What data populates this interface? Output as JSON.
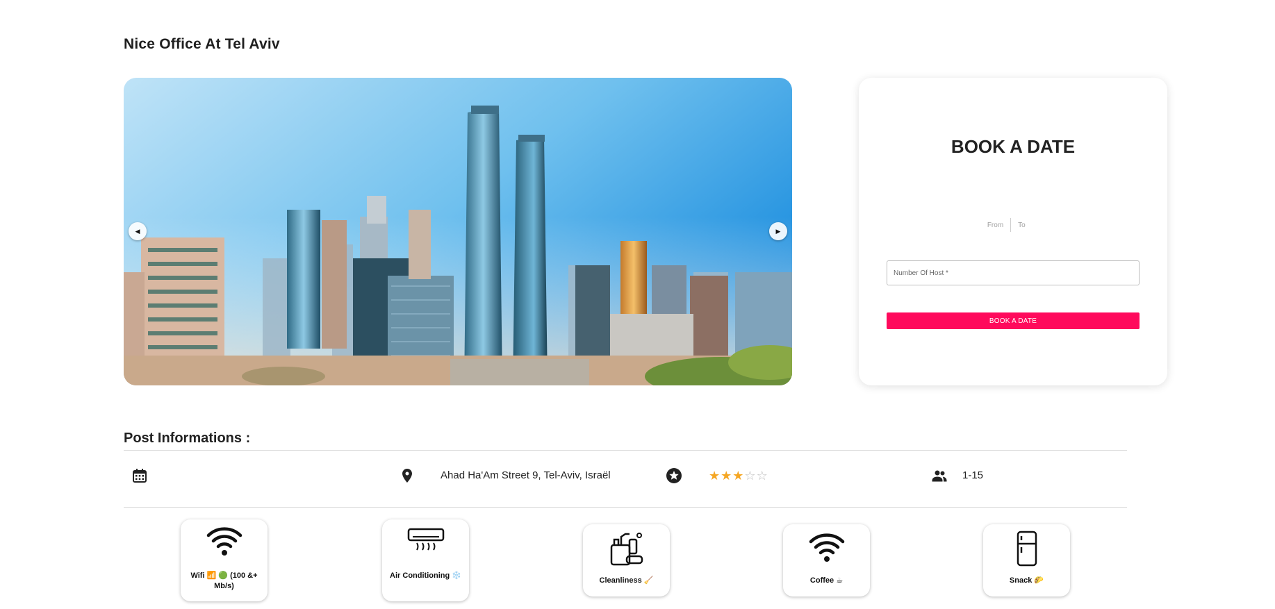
{
  "page": {
    "title": "Nice Office At Tel Aviv"
  },
  "carousel": {
    "image_alt": "Tel Aviv city skyline",
    "prev_icon": "chevron-left-icon",
    "next_icon": "chevron-right-icon"
  },
  "booking": {
    "title": "BOOK A DATE",
    "from_label": "From",
    "to_label": "To",
    "host_placeholder": "Number Of Host *",
    "button_label": "BOOK A DATE",
    "accent_color": "#ff0a5c"
  },
  "post_info": {
    "section_title": "Post Informations :",
    "address": "Ahad Ha'Am Street 9, Tel-Aviv, Israël",
    "rating": 3,
    "rating_max": 5,
    "capacity": "1-15",
    "icons": [
      "calendar-icon",
      "location-pin-icon",
      "star-badge-icon",
      "people-icon"
    ]
  },
  "amenities": [
    {
      "icon": "wifi-icon",
      "label": "Wifi 📶 🟢 (100 &+ Mb/s)"
    },
    {
      "icon": "air-conditioner-icon",
      "label": "Air Conditioning ❄️"
    },
    {
      "icon": "cleaning-supplies-icon",
      "label": "Cleanliness 🧹"
    },
    {
      "icon": "wifi-icon",
      "label": "Coffee ☕"
    },
    {
      "icon": "fridge-icon",
      "label": "Snack 🌮"
    }
  ],
  "colors": {
    "star_on": "#f5a623",
    "star_off": "#bdbdbd"
  }
}
